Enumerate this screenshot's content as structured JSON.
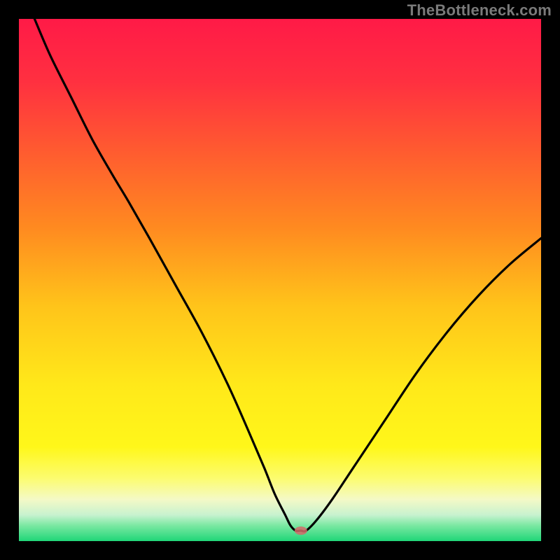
{
  "watermark": "TheBottleneck.com",
  "chart_data": {
    "type": "line",
    "title": "",
    "xlabel": "",
    "ylabel": "",
    "xlim": [
      0,
      100
    ],
    "ylim": [
      0,
      100
    ],
    "grid": false,
    "legend": false,
    "annotations": [
      {
        "type": "marker",
        "shape": "oval",
        "x": 54,
        "y": 2,
        "color": "#d46a6a"
      }
    ],
    "gradient_stops": [
      {
        "offset": 0.0,
        "color": "#ff1a47"
      },
      {
        "offset": 0.12,
        "color": "#ff3040"
      },
      {
        "offset": 0.25,
        "color": "#ff5a30"
      },
      {
        "offset": 0.4,
        "color": "#ff8a20"
      },
      {
        "offset": 0.55,
        "color": "#ffc41a"
      },
      {
        "offset": 0.7,
        "color": "#ffe81a"
      },
      {
        "offset": 0.82,
        "color": "#fff71a"
      },
      {
        "offset": 0.88,
        "color": "#fcfc70"
      },
      {
        "offset": 0.92,
        "color": "#f4f9c6"
      },
      {
        "offset": 0.95,
        "color": "#c7f2cf"
      },
      {
        "offset": 0.97,
        "color": "#7be8a2"
      },
      {
        "offset": 1.0,
        "color": "#20d678"
      }
    ],
    "series": [
      {
        "name": "bottleneck-curve",
        "color": "#000000",
        "x": [
          3,
          6,
          10,
          14,
          18,
          21,
          25,
          30,
          35,
          40,
          44,
          47,
          49,
          51,
          52,
          53,
          54,
          55,
          57,
          60,
          64,
          70,
          76,
          82,
          88,
          94,
          100
        ],
        "y": [
          100,
          93,
          85,
          77,
          70,
          65,
          58,
          49,
          40,
          30,
          21,
          14,
          9,
          5,
          3,
          2,
          2,
          2,
          4,
          8,
          14,
          23,
          32,
          40,
          47,
          53,
          58
        ]
      }
    ]
  }
}
